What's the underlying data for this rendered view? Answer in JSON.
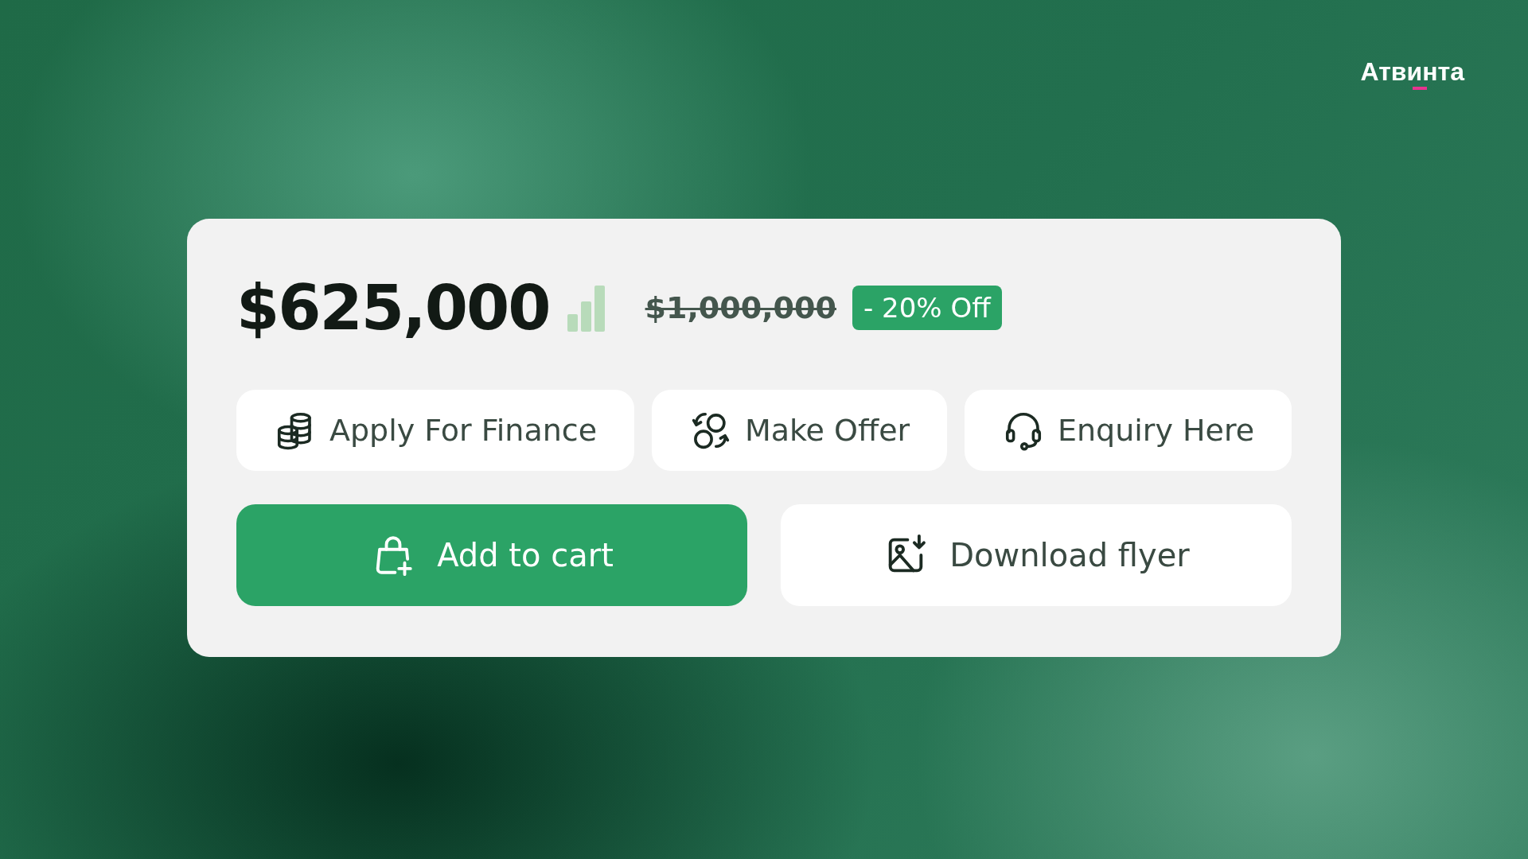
{
  "logo": {
    "text": "Атвинта"
  },
  "price": {
    "current": "$625,000",
    "original": "$1,000,000",
    "discount": "- 20% Off"
  },
  "actions": [
    {
      "label": "Apply For Finance",
      "kind": "finance"
    },
    {
      "label": "Make Offer",
      "kind": "offer"
    },
    {
      "label": "Enquiry Here",
      "kind": "enquiry"
    }
  ],
  "main_actions": [
    {
      "label": "Add to cart",
      "kind": "primary"
    },
    {
      "label": "Download flyer",
      "kind": "secondary"
    }
  ]
}
